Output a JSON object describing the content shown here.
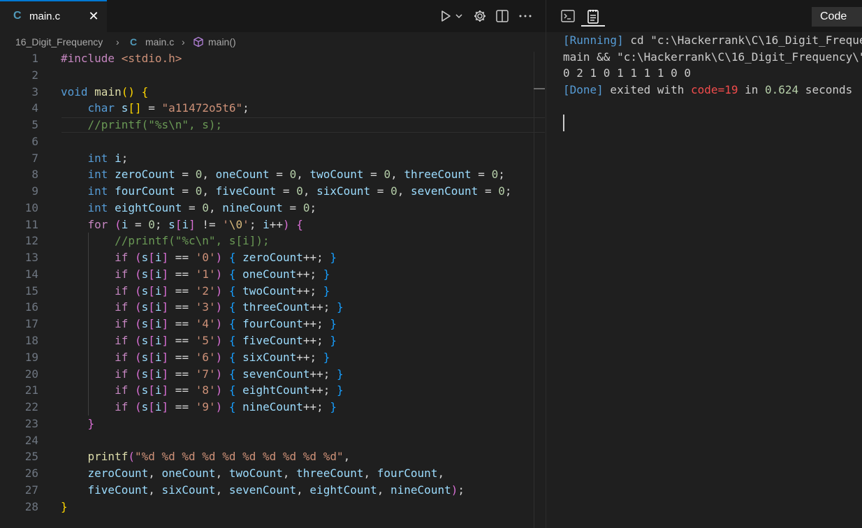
{
  "editor": {
    "tab_label": "main.c",
    "tab_icon_letter": "C",
    "close_glyph": "✕",
    "toolbar": [
      "run-icon",
      "chevron-down-icon",
      "gear-icon",
      "split-editor-icon",
      "more-icon"
    ],
    "breadcrumb": {
      "folder": "16_Digit_Frequency",
      "file_icon": "C",
      "file": "main.c",
      "symbol": "main()"
    },
    "line_numbers": [
      "1",
      "2",
      "3",
      "4",
      "5",
      "6",
      "7",
      "8",
      "9",
      "10",
      "11",
      "12",
      "13",
      "14",
      "15",
      "16",
      "17",
      "18",
      "19",
      "20",
      "21",
      "22",
      "23",
      "24",
      "25",
      "26",
      "27",
      "28"
    ],
    "code_lines": [
      "#include <stdio.h>",
      "",
      "void main() {",
      "    char s[] = \"a11472o5t6\";",
      "    //printf(\"%s\\n\", s);",
      "",
      "    int i;",
      "    int zeroCount = 0, oneCount = 0, twoCount = 0, threeCount = 0;",
      "    int fourCount = 0, fiveCount = 0, sixCount = 0, sevenCount = 0;",
      "    int eightCount = 0, nineCount = 0;",
      "    for (i = 0; s[i] != '\\0'; i++) {",
      "        //printf(\"%c\\n\", s[i]);",
      "        if (s[i] == '0') { zeroCount++; }",
      "        if (s[i] == '1') { oneCount++; }",
      "        if (s[i] == '2') { twoCount++; }",
      "        if (s[i] == '3') { threeCount++; }",
      "        if (s[i] == '4') { fourCount++; }",
      "        if (s[i] == '5') { fiveCount++; }",
      "        if (s[i] == '6') { sixCount++; }",
      "        if (s[i] == '7') { sevenCount++; }",
      "        if (s[i] == '8') { eightCount++; }",
      "        if (s[i] == '9') { nineCount++; }",
      "    }",
      "",
      "    printf(\"%d %d %d %d %d %d %d %d %d %d\",",
      "    zeroCount, oneCount, twoCount, threeCount, fourCount,",
      "    fiveCount, sixCount, sevenCount, eightCount, nineCount);",
      "}"
    ]
  },
  "output": {
    "tabs": [
      "terminal-icon",
      "output-log-icon"
    ],
    "select_value": "Code",
    "lines": [
      "[Running] cd \"c:\\Hackerrank\\C\\16_Digit_Freque",
      "main && \"c:\\Hackerrank\\C\\16_Digit_Frequency\\\"",
      "0 2 1 0 1 1 1 1 0 0",
      "[Done] exited with code=19 in 0.624 seconds"
    ],
    "done_prefix": "[Done]",
    "done_mid": " exited with ",
    "done_code": "code=19",
    "done_in": " in ",
    "done_time": "0.624",
    "done_suffix": " seconds",
    "running_prefix": "[Running]",
    "running_rest": " cd \"c:\\Hackerrank\\C\\16_Digit_Freque"
  }
}
